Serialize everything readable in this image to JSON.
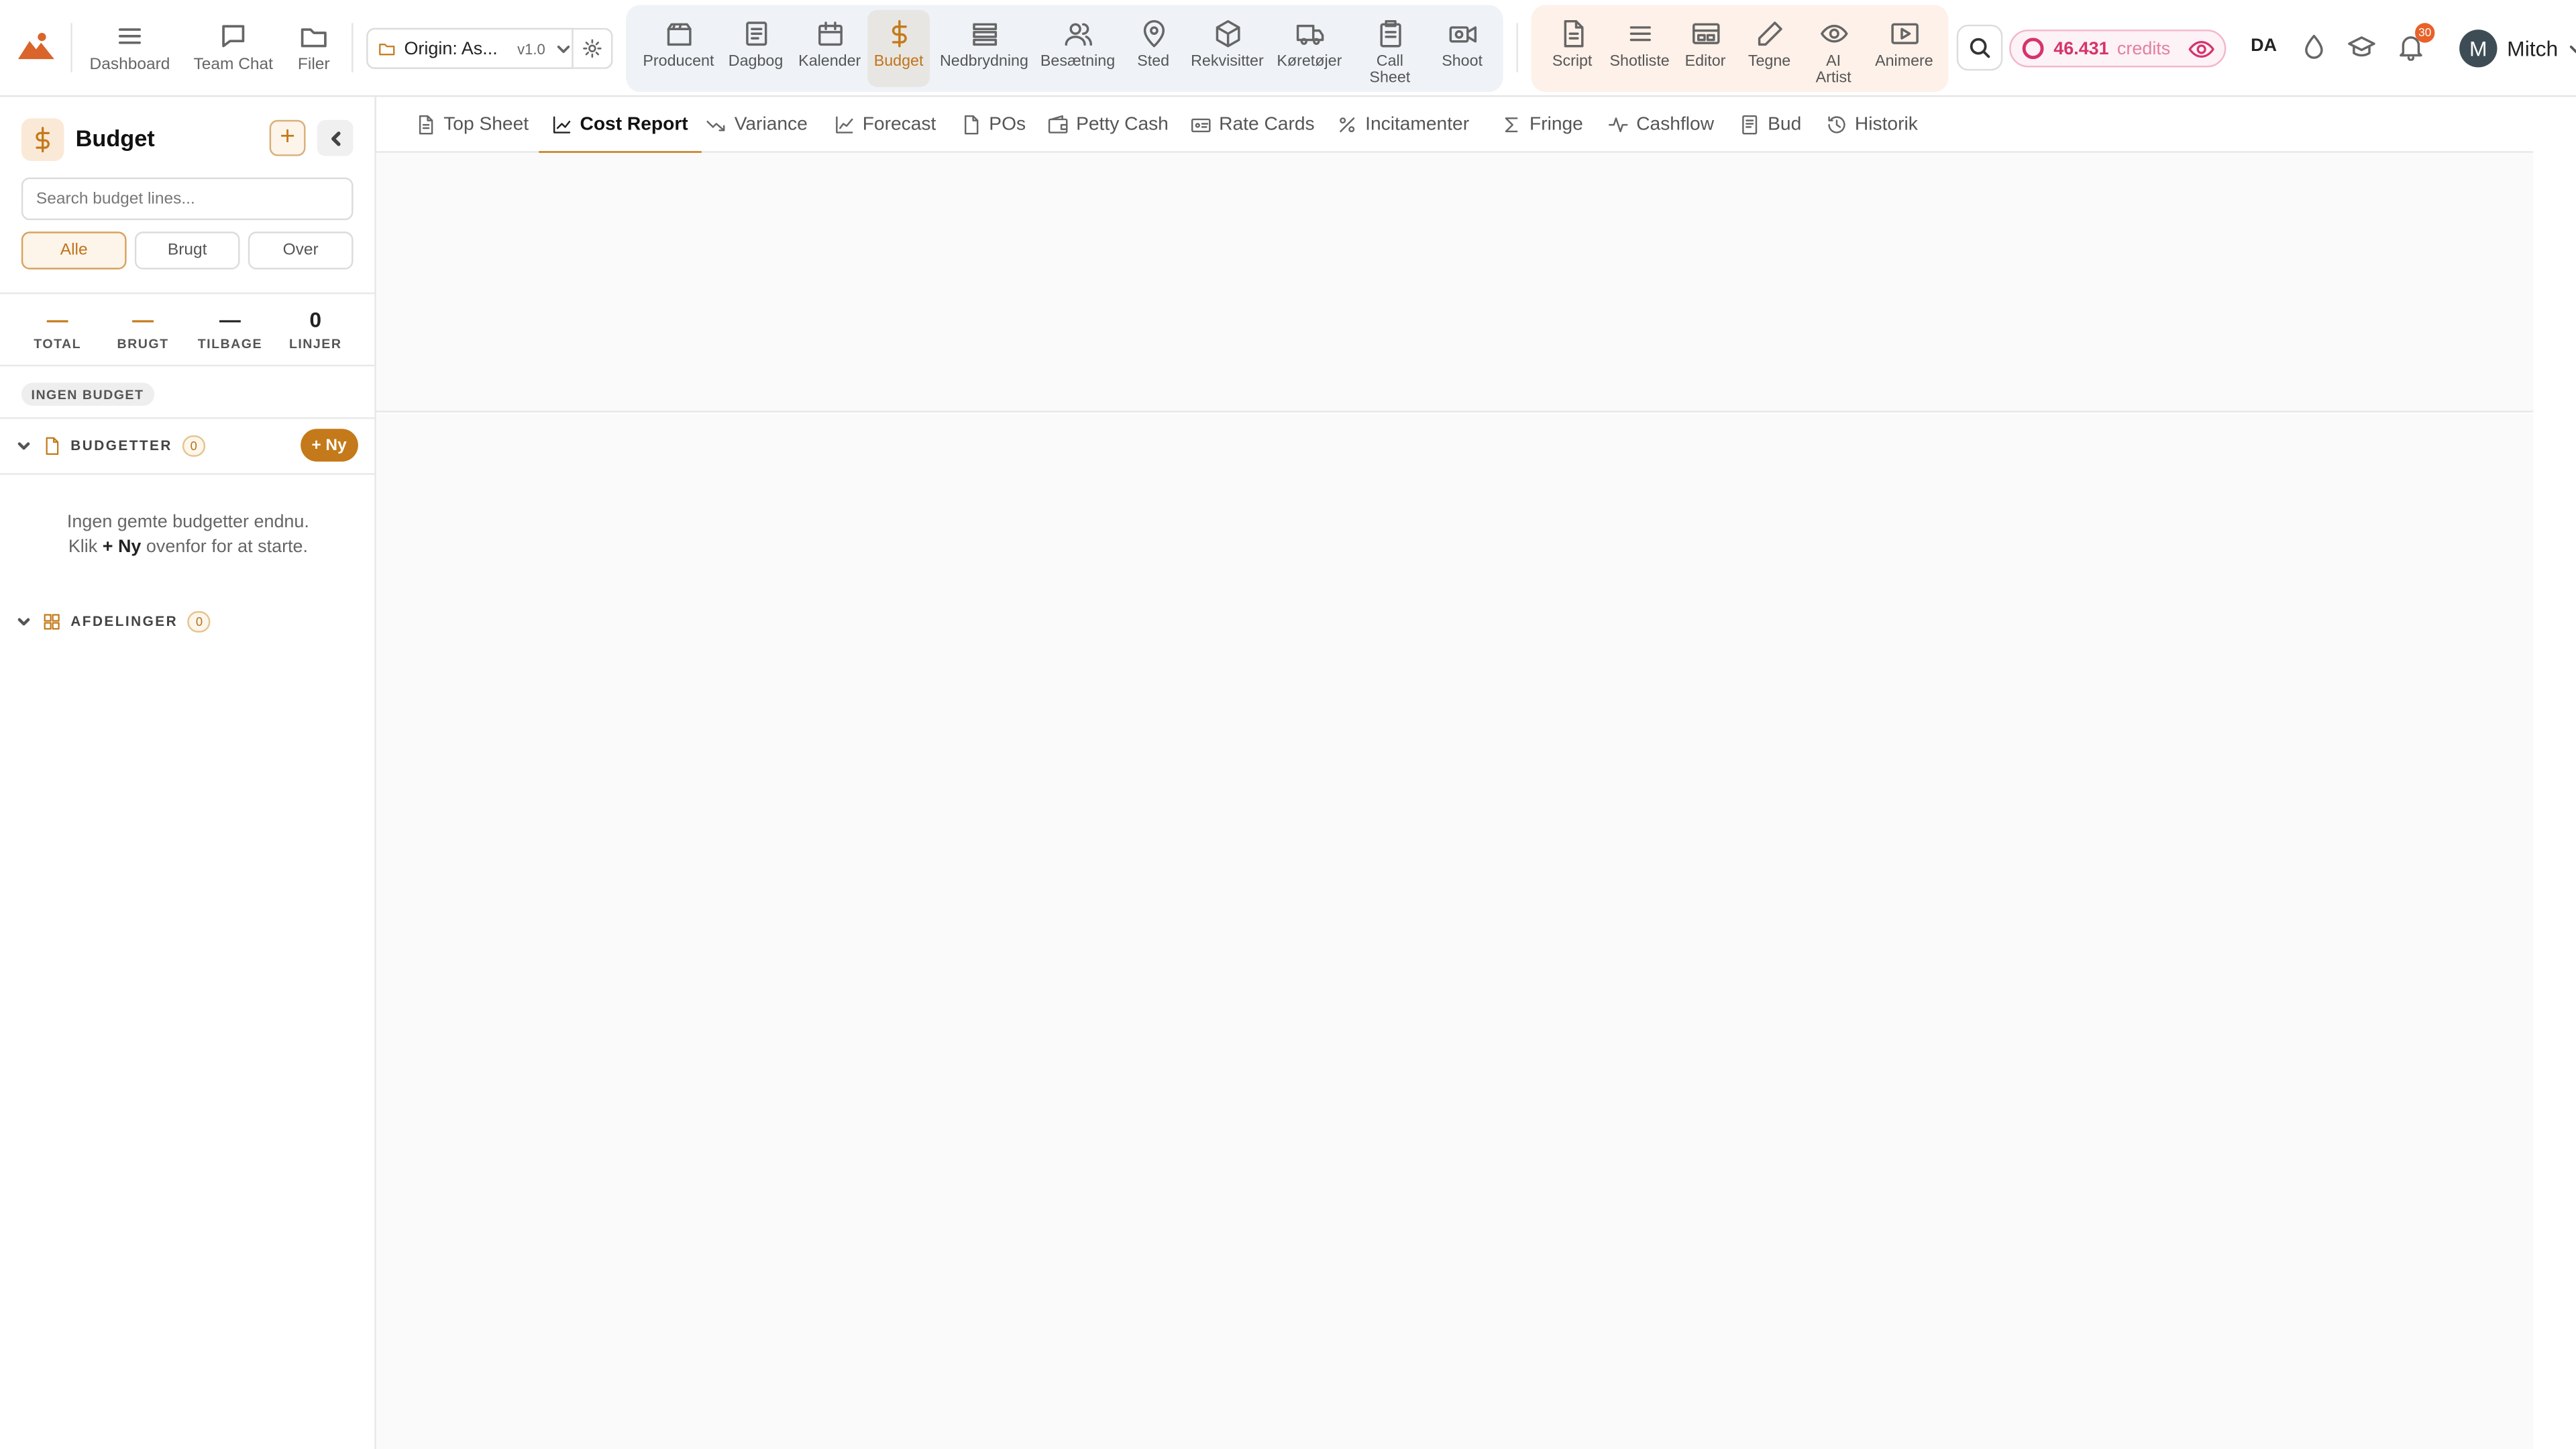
{
  "topbar": {
    "left_nav": [
      {
        "label": "Dashboard",
        "icon": "menu-icon"
      },
      {
        "label": "Team Chat",
        "icon": "chat-icon"
      },
      {
        "label": "Filer",
        "icon": "folder-icon"
      }
    ],
    "project": {
      "name": "Origin: As...",
      "version": "v1.0"
    },
    "production_tools": [
      {
        "label": "Producent",
        "icon": "clapper-icon"
      },
      {
        "label": "Dagbog",
        "icon": "notebook-icon"
      },
      {
        "label": "Kalender",
        "icon": "calendar-icon"
      },
      {
        "label": "Budget",
        "icon": "dollar-icon",
        "active": true
      },
      {
        "label": "Nedbrydning",
        "icon": "layers-icon"
      },
      {
        "label": "Besætning",
        "icon": "people-icon"
      },
      {
        "label": "Sted",
        "icon": "map-pin-icon"
      },
      {
        "label": "Rekvisitter",
        "icon": "box-icon"
      },
      {
        "label": "Køretøjer",
        "icon": "truck-icon"
      },
      {
        "label": "Call Sheet",
        "icon": "clipboard-icon"
      },
      {
        "label": "Shoot",
        "icon": "camera-icon"
      }
    ],
    "creative_tools": [
      {
        "label": "Script",
        "icon": "document-icon"
      },
      {
        "label": "Shotliste",
        "icon": "list-icon"
      },
      {
        "label": "Editor",
        "icon": "editor-icon"
      },
      {
        "label": "Tegne",
        "icon": "pencil-icon"
      },
      {
        "label": "AI Artist",
        "icon": "eye-icon"
      },
      {
        "label": "Animere",
        "icon": "play-icon"
      }
    ],
    "credits": {
      "value": "46.431",
      "label": "credits"
    },
    "language": "DA",
    "notifications": "30",
    "user": {
      "initial": "M",
      "name": "Mitch"
    }
  },
  "sidebar": {
    "title": "Budget",
    "search_placeholder": "Search budget lines...",
    "filters": [
      {
        "label": "Alle",
        "active": true
      },
      {
        "label": "Brugt"
      },
      {
        "label": "Over"
      }
    ],
    "stats": [
      {
        "value": "—",
        "label": "TOTAL",
        "color": "#c47a1a"
      },
      {
        "value": "—",
        "label": "BRUGT",
        "color": "#c47a1a"
      },
      {
        "value": "—",
        "label": "TILBAGE",
        "color": "#222222"
      },
      {
        "value": "0",
        "label": "LINJER",
        "color": "#222222"
      }
    ],
    "no_budget_badge": "INGEN BUDGET",
    "budgets_section": {
      "label": "BUDGETTER",
      "count": "0",
      "new_label": "+ Ny"
    },
    "empty_line1": "Ingen gemte budgetter endnu.",
    "empty_line2_pre": "Klik",
    "empty_line2_bold": "+ Ny",
    "empty_line2_post": "ovenfor for at starte.",
    "departments_section": {
      "label": "AFDELINGER",
      "count": "0"
    }
  },
  "tabs": [
    {
      "label": "Top Sheet",
      "icon": "document-icon"
    },
    {
      "label": "Cost Report",
      "icon": "line-chart-icon",
      "active": true
    },
    {
      "label": "Variance",
      "icon": "trend-down-icon"
    },
    {
      "label": "Forecast",
      "icon": "chart-icon"
    },
    {
      "label": "POs",
      "icon": "file-icon"
    },
    {
      "label": "Petty Cash",
      "icon": "wallet-icon"
    },
    {
      "label": "Rate Cards",
      "icon": "card-icon"
    },
    {
      "label": "Incitamenter",
      "icon": "percent-icon"
    },
    {
      "label": "Fringe",
      "icon": "sigma-icon"
    },
    {
      "label": "Cashflow",
      "icon": "pulse-icon"
    },
    {
      "label": "Bud",
      "icon": "receipt-icon"
    },
    {
      "label": "Historik",
      "icon": "history-icon"
    }
  ],
  "colors": {
    "accent": "#c47a1a",
    "credits": "#d6336c",
    "badge": "#e8612a"
  }
}
